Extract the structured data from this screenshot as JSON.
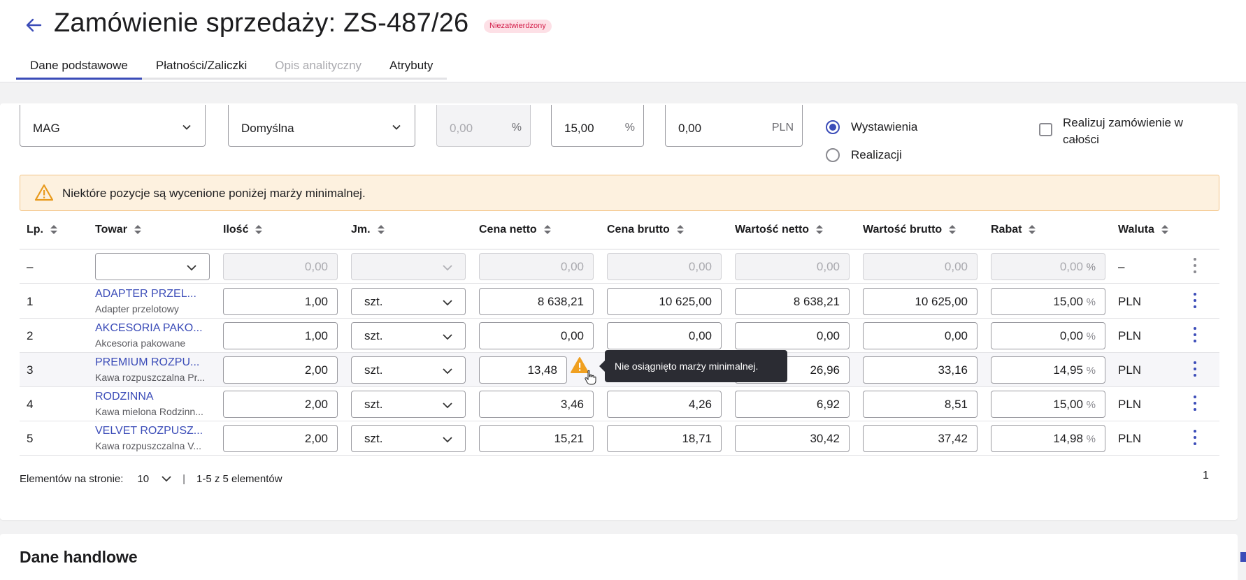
{
  "header": {
    "title": "Zamówienie sprzedaży: ZS-487/26",
    "status_badge": "Niezatwierdzony",
    "tabs": [
      {
        "label": "Dane podstawowe",
        "state": "active"
      },
      {
        "label": "Płatności/Zaliczki",
        "state": "normal"
      },
      {
        "label": "Opis analityczny",
        "state": "disabled"
      },
      {
        "label": "Atrybuty",
        "state": "normal"
      }
    ]
  },
  "fields": {
    "warehouse": {
      "value": "MAG"
    },
    "price": {
      "value": "Domyślna"
    },
    "payment_discount": {
      "value": "0,00",
      "suffix": "%"
    },
    "general_discount": {
      "value": "15,00",
      "suffix": "%"
    },
    "discount_amount": {
      "value": "0,00",
      "suffix": "PLN"
    },
    "date_options": [
      {
        "label": "Wystawienia",
        "selected": true
      },
      {
        "label": "Realizacji",
        "selected": false
      }
    ],
    "realize_full": {
      "label": "Realizuj zamówienie w całości",
      "checked": false
    }
  },
  "warning": {
    "text": "Niektóre pozycje są wycenione poniżej marży minimalnej.",
    "color": "#fdf1df"
  },
  "table": {
    "columns": [
      "Lp.",
      "Towar",
      "Ilość",
      "Jm.",
      "Cena netto",
      "Cena brutto",
      "Wartość netto",
      "Wartość brutto",
      "Rabat",
      "Waluta"
    ],
    "new_row": {
      "lp": "–",
      "qty": "0,00",
      "net_price": "0,00",
      "gross_price": "0,00",
      "net_value": "0,00",
      "gross_value": "0,00",
      "discount": "0,00",
      "discount_unit": "%",
      "currency": "–"
    },
    "rows": [
      {
        "lp": "1",
        "name": "ADAPTER PRZEL...",
        "desc": "Adapter przelotowy",
        "qty": "1,00",
        "unit": "szt.",
        "net_price": "8 638,21",
        "gross_price": "10 625,00",
        "net_value": "8 638,21",
        "gross_value": "10 625,00",
        "discount": "15,00",
        "discount_unit": "%",
        "currency": "PLN"
      },
      {
        "lp": "2",
        "name": "AKCESORIA PAKO...",
        "desc": "Akcesoria pakowane",
        "qty": "1,00",
        "unit": "szt.",
        "net_price": "0,00",
        "gross_price": "0,00",
        "net_value": "0,00",
        "gross_value": "0,00",
        "discount": "0,00",
        "discount_unit": "%",
        "currency": "PLN"
      },
      {
        "lp": "3",
        "name": "PREMIUM ROZPU...",
        "desc": "Kawa rozpuszczalna Pr...",
        "qty": "2,00",
        "unit": "szt.",
        "net_price": "13,48",
        "gross_price": "",
        "net_value": "26,96",
        "gross_value": "33,16",
        "discount": "14,95",
        "discount_unit": "%",
        "currency": "PLN"
      },
      {
        "lp": "4",
        "name": "RODZINNA",
        "desc": "Kawa mielona Rodzinn...",
        "qty": "2,00",
        "unit": "szt.",
        "net_price": "3,46",
        "gross_price": "4,26",
        "net_value": "6,92",
        "gross_value": "8,51",
        "discount": "15,00",
        "discount_unit": "%",
        "currency": "PLN"
      },
      {
        "lp": "5",
        "name": "VELVET ROZPUSZ...",
        "desc": "Kawa rozpuszczalna V...",
        "qty": "2,00",
        "unit": "szt.",
        "net_price": "15,21",
        "gross_price": "18,71",
        "net_value": "30,42",
        "gross_value": "37,42",
        "discount": "14,98",
        "discount_unit": "%",
        "currency": "PLN"
      }
    ],
    "tooltip": "Nie osiągnięto marży minimalnej."
  },
  "pager": {
    "label": "Elementów na stronie:",
    "page_size": "10",
    "separator": "|",
    "range": "1-5 z 5 elementów",
    "page": "1"
  },
  "section2": {
    "title": "Dane handlowe"
  },
  "colors": {
    "accent": "#3b4cb8",
    "badge_text": "#d3204b",
    "warning_icon": "#f0a020"
  }
}
